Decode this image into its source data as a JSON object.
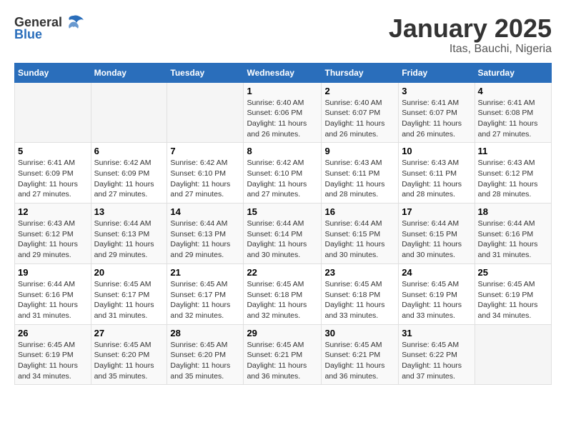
{
  "logo": {
    "general": "General",
    "blue": "Blue"
  },
  "title": "January 2025",
  "subtitle": "Itas, Bauchi, Nigeria",
  "days_header": [
    "Sunday",
    "Monday",
    "Tuesday",
    "Wednesday",
    "Thursday",
    "Friday",
    "Saturday"
  ],
  "weeks": [
    {
      "cells": [
        {
          "day": "",
          "info": ""
        },
        {
          "day": "",
          "info": ""
        },
        {
          "day": "",
          "info": ""
        },
        {
          "day": "1",
          "info": "Sunrise: 6:40 AM\nSunset: 6:06 PM\nDaylight: 11 hours and 26 minutes."
        },
        {
          "day": "2",
          "info": "Sunrise: 6:40 AM\nSunset: 6:07 PM\nDaylight: 11 hours and 26 minutes."
        },
        {
          "day": "3",
          "info": "Sunrise: 6:41 AM\nSunset: 6:07 PM\nDaylight: 11 hours and 26 minutes."
        },
        {
          "day": "4",
          "info": "Sunrise: 6:41 AM\nSunset: 6:08 PM\nDaylight: 11 hours and 27 minutes."
        }
      ]
    },
    {
      "cells": [
        {
          "day": "5",
          "info": "Sunrise: 6:41 AM\nSunset: 6:09 PM\nDaylight: 11 hours and 27 minutes."
        },
        {
          "day": "6",
          "info": "Sunrise: 6:42 AM\nSunset: 6:09 PM\nDaylight: 11 hours and 27 minutes."
        },
        {
          "day": "7",
          "info": "Sunrise: 6:42 AM\nSunset: 6:10 PM\nDaylight: 11 hours and 27 minutes."
        },
        {
          "day": "8",
          "info": "Sunrise: 6:42 AM\nSunset: 6:10 PM\nDaylight: 11 hours and 27 minutes."
        },
        {
          "day": "9",
          "info": "Sunrise: 6:43 AM\nSunset: 6:11 PM\nDaylight: 11 hours and 28 minutes."
        },
        {
          "day": "10",
          "info": "Sunrise: 6:43 AM\nSunset: 6:11 PM\nDaylight: 11 hours and 28 minutes."
        },
        {
          "day": "11",
          "info": "Sunrise: 6:43 AM\nSunset: 6:12 PM\nDaylight: 11 hours and 28 minutes."
        }
      ]
    },
    {
      "cells": [
        {
          "day": "12",
          "info": "Sunrise: 6:43 AM\nSunset: 6:12 PM\nDaylight: 11 hours and 29 minutes."
        },
        {
          "day": "13",
          "info": "Sunrise: 6:44 AM\nSunset: 6:13 PM\nDaylight: 11 hours and 29 minutes."
        },
        {
          "day": "14",
          "info": "Sunrise: 6:44 AM\nSunset: 6:13 PM\nDaylight: 11 hours and 29 minutes."
        },
        {
          "day": "15",
          "info": "Sunrise: 6:44 AM\nSunset: 6:14 PM\nDaylight: 11 hours and 30 minutes."
        },
        {
          "day": "16",
          "info": "Sunrise: 6:44 AM\nSunset: 6:15 PM\nDaylight: 11 hours and 30 minutes."
        },
        {
          "day": "17",
          "info": "Sunrise: 6:44 AM\nSunset: 6:15 PM\nDaylight: 11 hours and 30 minutes."
        },
        {
          "day": "18",
          "info": "Sunrise: 6:44 AM\nSunset: 6:16 PM\nDaylight: 11 hours and 31 minutes."
        }
      ]
    },
    {
      "cells": [
        {
          "day": "19",
          "info": "Sunrise: 6:44 AM\nSunset: 6:16 PM\nDaylight: 11 hours and 31 minutes."
        },
        {
          "day": "20",
          "info": "Sunrise: 6:45 AM\nSunset: 6:17 PM\nDaylight: 11 hours and 31 minutes."
        },
        {
          "day": "21",
          "info": "Sunrise: 6:45 AM\nSunset: 6:17 PM\nDaylight: 11 hours and 32 minutes."
        },
        {
          "day": "22",
          "info": "Sunrise: 6:45 AM\nSunset: 6:18 PM\nDaylight: 11 hours and 32 minutes."
        },
        {
          "day": "23",
          "info": "Sunrise: 6:45 AM\nSunset: 6:18 PM\nDaylight: 11 hours and 33 minutes."
        },
        {
          "day": "24",
          "info": "Sunrise: 6:45 AM\nSunset: 6:19 PM\nDaylight: 11 hours and 33 minutes."
        },
        {
          "day": "25",
          "info": "Sunrise: 6:45 AM\nSunset: 6:19 PM\nDaylight: 11 hours and 34 minutes."
        }
      ]
    },
    {
      "cells": [
        {
          "day": "26",
          "info": "Sunrise: 6:45 AM\nSunset: 6:19 PM\nDaylight: 11 hours and 34 minutes."
        },
        {
          "day": "27",
          "info": "Sunrise: 6:45 AM\nSunset: 6:20 PM\nDaylight: 11 hours and 35 minutes."
        },
        {
          "day": "28",
          "info": "Sunrise: 6:45 AM\nSunset: 6:20 PM\nDaylight: 11 hours and 35 minutes."
        },
        {
          "day": "29",
          "info": "Sunrise: 6:45 AM\nSunset: 6:21 PM\nDaylight: 11 hours and 36 minutes."
        },
        {
          "day": "30",
          "info": "Sunrise: 6:45 AM\nSunset: 6:21 PM\nDaylight: 11 hours and 36 minutes."
        },
        {
          "day": "31",
          "info": "Sunrise: 6:45 AM\nSunset: 6:22 PM\nDaylight: 11 hours and 37 minutes."
        },
        {
          "day": "",
          "info": ""
        }
      ]
    }
  ]
}
